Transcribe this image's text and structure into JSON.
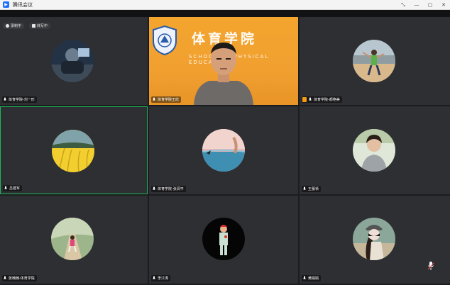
{
  "window": {
    "app_title": "腾讯会议",
    "controls": [
      "⤡",
      "—",
      "▢",
      "✕"
    ]
  },
  "status": {
    "recording": "录制中",
    "transcribing": "转写中"
  },
  "featured": {
    "sign_text": "体育学院",
    "sub_text": "SCHOOL OF PHYSICAL EDUCATION"
  },
  "participants": [
    {
      "name": "体育学院-刘一形"
    },
    {
      "name": "体育学院王欣"
    },
    {
      "name": "体育学院-郝艳美"
    },
    {
      "name": "吕建军"
    },
    {
      "name": "体育学院-张洞平"
    },
    {
      "name": "王蕾祯"
    },
    {
      "name": "张楠楠-体育学院"
    },
    {
      "name": "李江涛"
    },
    {
      "name": "黄娟娟"
    }
  ],
  "colors": {
    "active_border": "#1fb85b",
    "tile_bg": "#2e2f33",
    "app_blue": "#1f6fff",
    "share_badge": "#f39c12"
  }
}
